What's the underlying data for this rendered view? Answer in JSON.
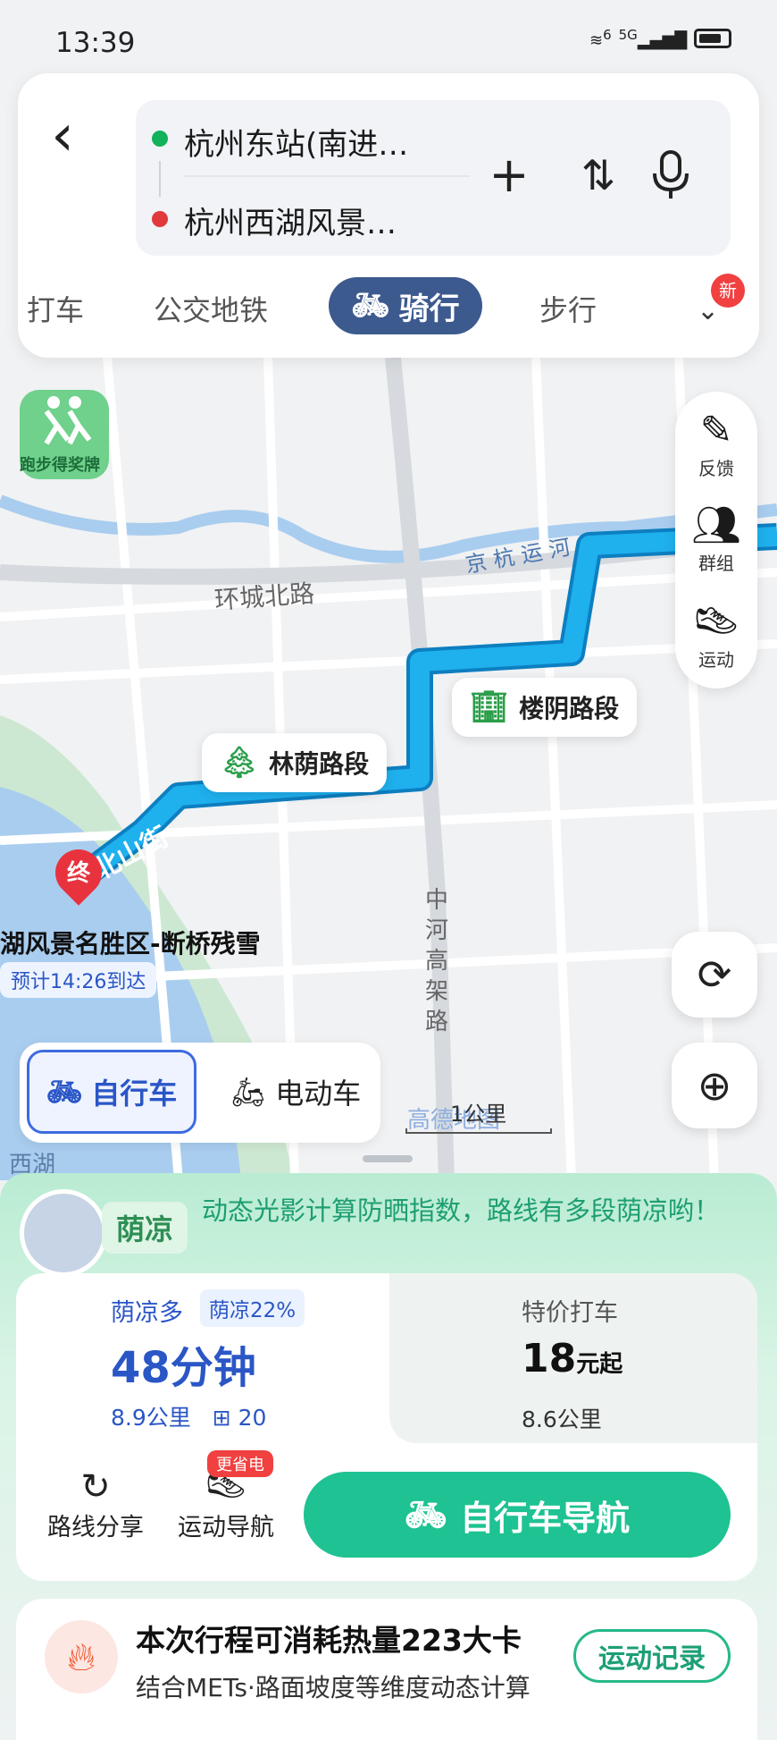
{
  "status_bar": {
    "time": "13:39",
    "signal_labels": [
      "6",
      "5G"
    ],
    "icons": [
      "wifi-icon",
      "cellular-signal-icon",
      "battery-icon"
    ]
  },
  "route": {
    "from": "杭州东站(南进…",
    "to": "杭州西湖风景…",
    "icons": [
      "back-icon",
      "add-waypoint-icon",
      "swap-icon",
      "microphone-icon"
    ]
  },
  "modes": {
    "tabs": [
      "打车",
      "公交地铁",
      "骑行",
      "步行"
    ],
    "active": "骑行",
    "new_badge": "新"
  },
  "map": {
    "award_label": "跑步得奖牌",
    "tools": [
      {
        "label": "反馈",
        "icon": "edit-icon"
      },
      {
        "label": "群组",
        "icon": "group-icon"
      },
      {
        "label": "运动",
        "icon": "sport-icon"
      }
    ],
    "road_labels": {
      "canal": "京 杭 运 河",
      "ring_road": "环城北路",
      "north_hill": "北山街",
      "viaduct": "中河高架路",
      "lake": "西湖"
    },
    "callouts": [
      {
        "label": "林荫路段",
        "icon": "tree-icon"
      },
      {
        "label": "楼阴路段",
        "icon": "building-icon"
      }
    ],
    "end_marker": "终",
    "destination": "湖风景名胜区-断桥残雪",
    "eta": "预计14:26到达",
    "scale": "1公里",
    "watermark": "高德地图",
    "colors": {
      "route": "#1a9fe0",
      "route_border": "#0d7fc0",
      "water": "#a9cdef",
      "park": "#cde8d2"
    }
  },
  "vehicle": {
    "options": [
      "自行车",
      "电动车"
    ],
    "active": "自行车"
  },
  "shade": {
    "tag": "荫凉",
    "description": "动态光影计算防晒指数，路线有多段荫凉哟！"
  },
  "plan": {
    "tag": "荫凉多",
    "shade_percent": "荫凉22%",
    "duration": "48分钟",
    "distance": "8.9公里",
    "traffic_lights": "20",
    "taxi_title": "特价打车",
    "taxi_price": "18",
    "taxi_unit": "元起",
    "taxi_distance": "8.6公里"
  },
  "actions": {
    "share": "路线分享",
    "sport_nav": "运动导航",
    "sport_badge": "更省电",
    "navigate": "自行车导航"
  },
  "calorie": {
    "title": "本次行程可消耗热量223大卡",
    "subtitle": "结合METs·路面坡度等维度动态计算",
    "record_button": "运动记录"
  }
}
